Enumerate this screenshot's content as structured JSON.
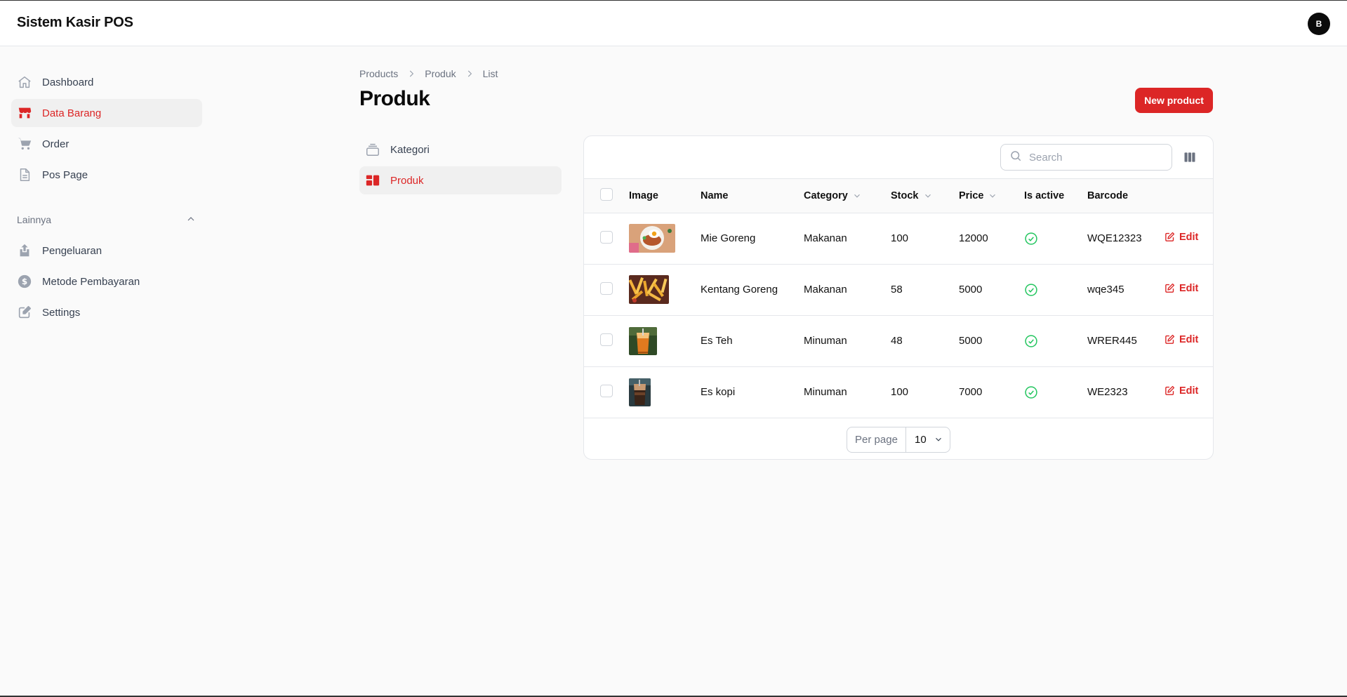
{
  "app": {
    "title": "Sistem Kasir POS",
    "user_initial": "B"
  },
  "sidebar": {
    "items": [
      {
        "label": "Dashboard",
        "icon": "home-icon",
        "active": false
      },
      {
        "label": "Data Barang",
        "icon": "store-icon",
        "active": true
      },
      {
        "label": "Order",
        "icon": "cart-icon",
        "active": false
      },
      {
        "label": "Pos Page",
        "icon": "document-icon",
        "active": false
      }
    ],
    "group": {
      "label": "Lainnya",
      "items": [
        {
          "label": "Pengeluaran",
          "icon": "upload-icon"
        },
        {
          "label": "Metode Pembayaran",
          "icon": "dollar-icon"
        },
        {
          "label": "Settings",
          "icon": "edit-icon"
        }
      ]
    }
  },
  "breadcrumb": [
    "Products",
    "Produk",
    "List"
  ],
  "page": {
    "title": "Produk",
    "new_button": "New product"
  },
  "subnav": [
    {
      "label": "Kategori",
      "icon": "rectangle-stack-icon",
      "active": false
    },
    {
      "label": "Produk",
      "icon": "squares-icon",
      "active": true
    }
  ],
  "table": {
    "search_placeholder": "Search",
    "columns": [
      "Image",
      "Name",
      "Category",
      "Stock",
      "Price",
      "Is active",
      "Barcode"
    ],
    "edit_label": "Edit",
    "rows": [
      {
        "name": "Mie Goreng",
        "category": "Makanan",
        "stock": "100",
        "price": "12000",
        "active": true,
        "barcode": "WQE12323",
        "image": "fried-noodles-photo"
      },
      {
        "name": "Kentang Goreng",
        "category": "Makanan",
        "stock": "58",
        "price": "5000",
        "active": true,
        "barcode": "wqe345",
        "image": "french-fries-photo"
      },
      {
        "name": "Es Teh",
        "category": "Minuman",
        "stock": "48",
        "price": "5000",
        "active": true,
        "barcode": "WRER445",
        "image": "iced-tea-photo"
      },
      {
        "name": "Es kopi",
        "category": "Minuman",
        "stock": "100",
        "price": "7000",
        "active": true,
        "barcode": "WE2323",
        "image": "iced-coffee-photo"
      }
    ],
    "per_page_label": "Per page",
    "per_page_value": "10"
  },
  "colors": {
    "accent": "#dc2626",
    "success": "#22c55e",
    "background": "#fafafa"
  }
}
